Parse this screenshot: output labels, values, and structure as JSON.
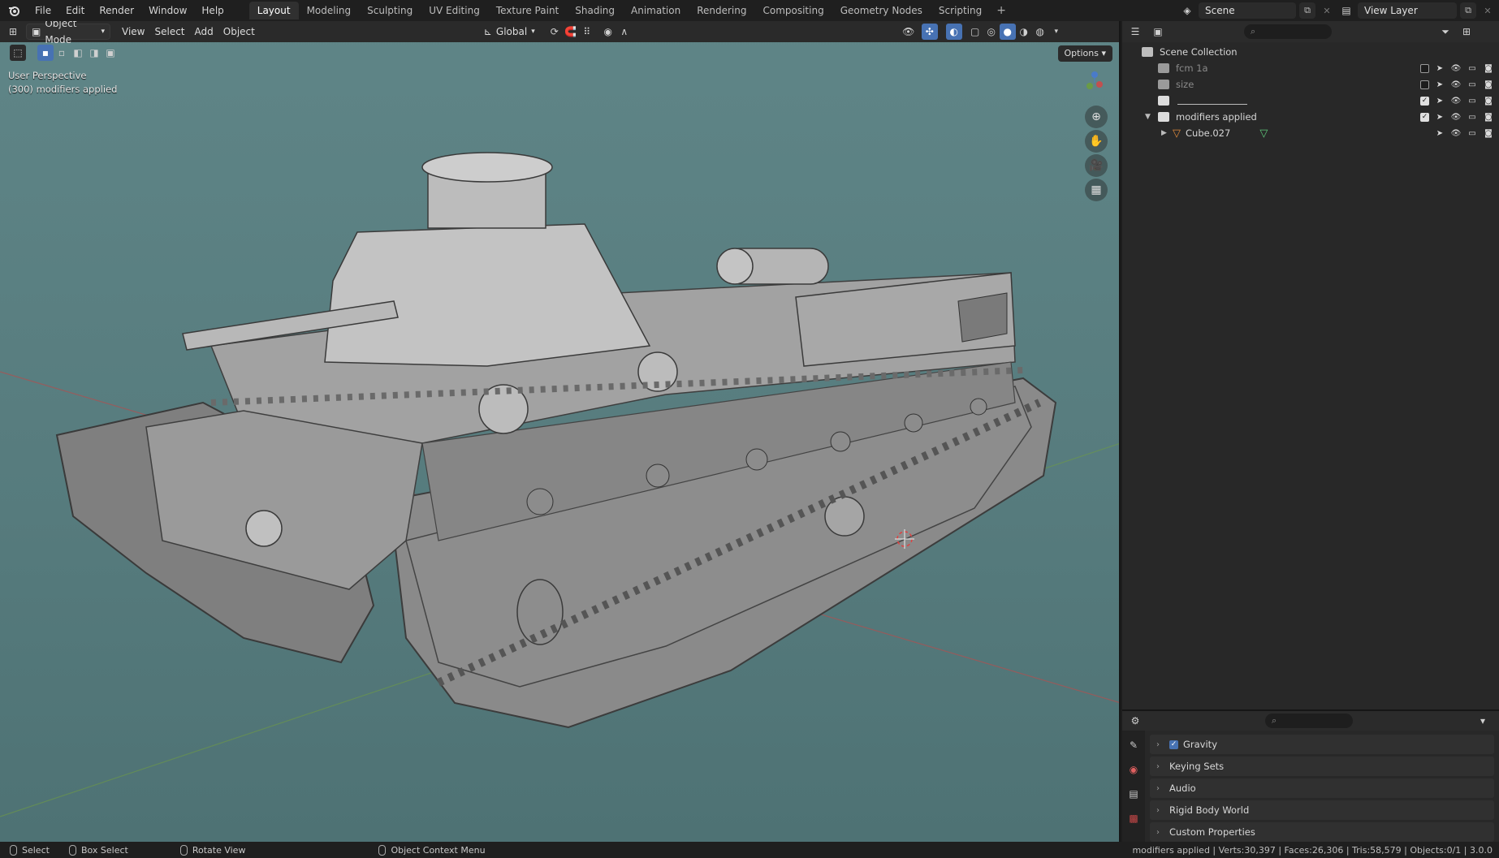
{
  "topbar": {
    "menus": [
      "File",
      "Edit",
      "Render",
      "Window",
      "Help"
    ],
    "workspaces": [
      "Layout",
      "Modeling",
      "Sculpting",
      "UV Editing",
      "Texture Paint",
      "Shading",
      "Animation",
      "Rendering",
      "Compositing",
      "Geometry Nodes",
      "Scripting"
    ],
    "active_workspace": "Layout",
    "scene": "Scene",
    "view_layer": "View Layer"
  },
  "viewport": {
    "mode": "Object Mode",
    "menus": [
      "View",
      "Select",
      "Add",
      "Object"
    ],
    "transform_orientation": "Global",
    "options_label": "Options",
    "perspective_label": "User Perspective",
    "collection_label": "(300) modifiers applied",
    "background_color": "#5a8082"
  },
  "outliner": {
    "root": "Scene Collection",
    "rows": [
      {
        "label": "fcm 1a",
        "dim": true,
        "checked": false
      },
      {
        "label": "size",
        "dim": true,
        "checked": false
      },
      {
        "label": "",
        "dim": false,
        "checked": true
      },
      {
        "label": "modifiers applied",
        "dim": false,
        "checked": true
      },
      {
        "label": "Cube.027",
        "dim": false,
        "checked": null
      }
    ]
  },
  "properties": {
    "panels": [
      "Gravity",
      "Keying Sets",
      "Audio",
      "Rigid Body World",
      "Custom Properties"
    ]
  },
  "statusbar": {
    "select": "Select",
    "box_select": "Box Select",
    "rotate_view": "Rotate View",
    "context_menu": "Object Context Menu",
    "stats": "modifiers applied | Verts:30,397 | Faces:26,306 | Tris:58,579 | Objects:0/1 | 3.0.0"
  },
  "colors": {
    "accent": "#4772b3",
    "mesh": "#9c9c9c",
    "grid_x": "#b45050",
    "grid_y": "#6f9b45"
  }
}
